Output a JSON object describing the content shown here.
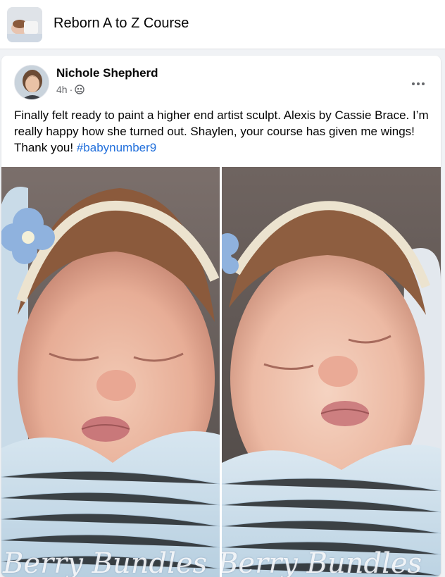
{
  "group": {
    "name": "Reborn A to Z Course",
    "thumbnail_icon": "group-photo"
  },
  "post": {
    "author": "Nichole Shepherd",
    "time": "4h",
    "separator": "·",
    "privacy_icon": "group-members-icon",
    "more_icon": "more-options-icon",
    "text": "Finally felt ready to paint a higher end artist sculpt.  Alexis by Cassie Brace.  I’m really happy how she turned out.  Shaylen, your course has given me wings! Thank you! ",
    "hashtag": "#babynumber9",
    "photos": [
      {
        "watermark": "Berry Bundles"
      },
      {
        "watermark": "Berry Bundles"
      }
    ]
  },
  "colors": {
    "hashtag": "#216fdb",
    "meta": "#65676b",
    "background": "#f0f2f5"
  }
}
